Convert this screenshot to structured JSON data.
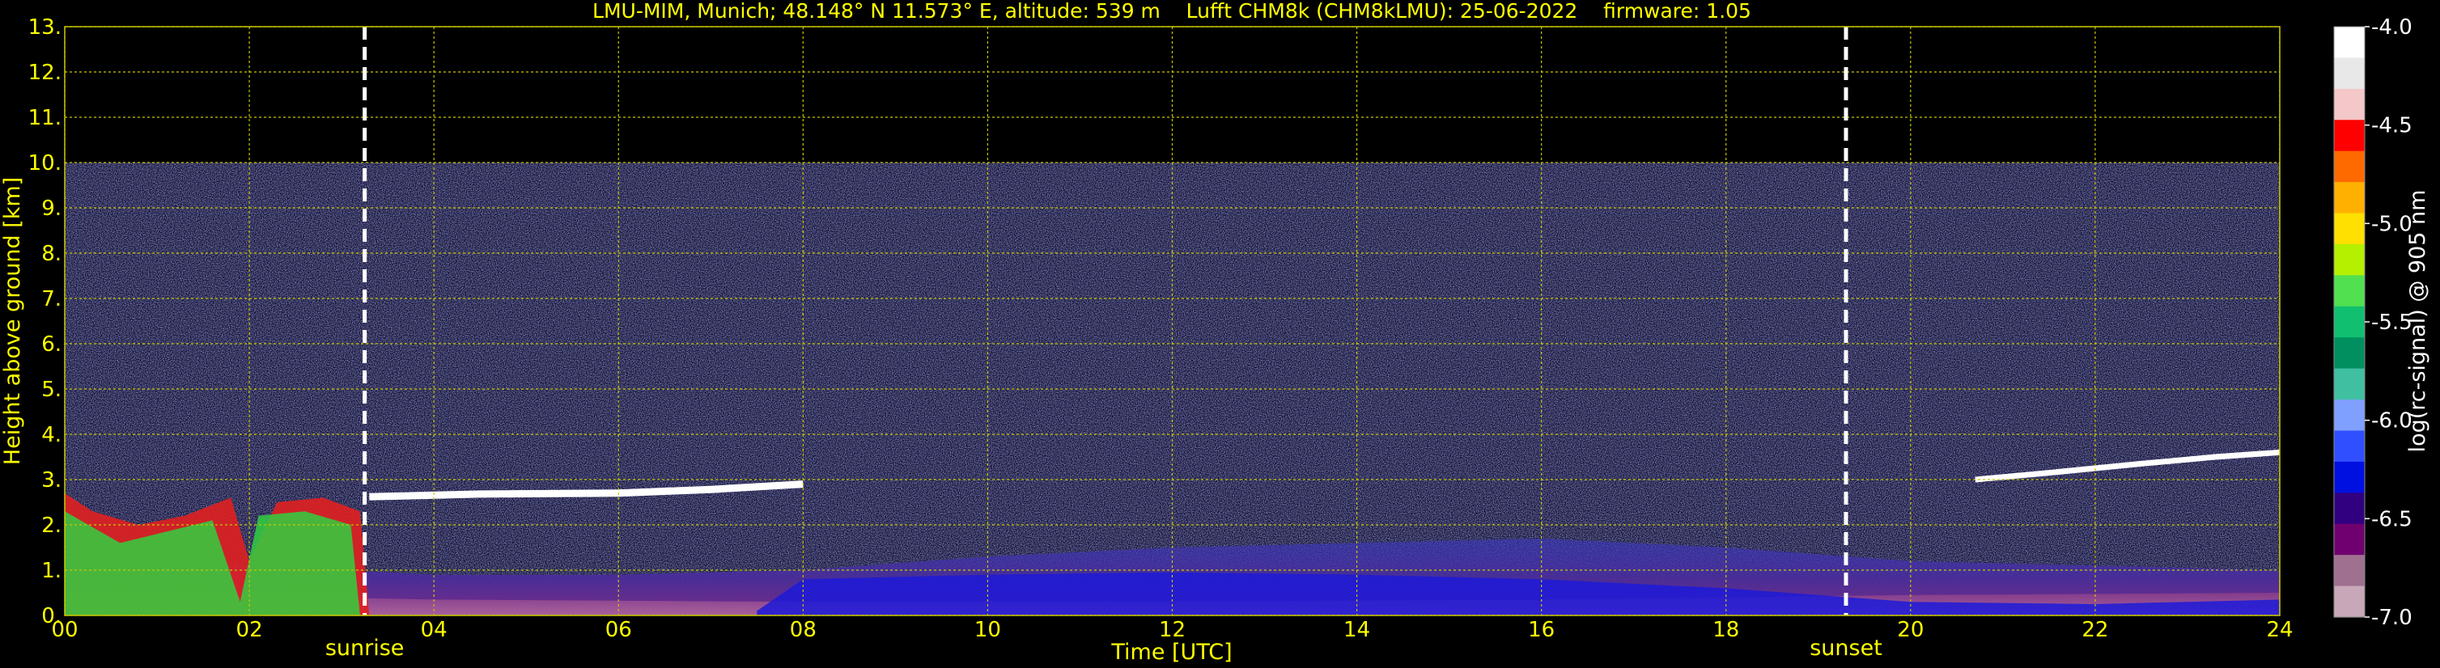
{
  "chart_data": {
    "type": "heatmap",
    "title": "LMU-MIM, Munich; 48.148° N 11.573° E, altitude: 539 m    Lufft CHM8k (CHM8kLMU): 25-06-2022    firmware: 1.05",
    "xlabel": "Time [UTC]",
    "ylabel": "Height above ground [km]",
    "xlim": [
      0,
      24
    ],
    "ylim": [
      0,
      13
    ],
    "x_ticks": [
      "00",
      "02",
      "04",
      "06",
      "08",
      "10",
      "12",
      "14",
      "16",
      "18",
      "20",
      "22",
      "24"
    ],
    "y_ticks": [
      "0.",
      "1.",
      "2.",
      "3.",
      "4.",
      "5.",
      "6.",
      "7.",
      "8.",
      "9.",
      "10.",
      "11.",
      "12.",
      "13."
    ],
    "grid": true,
    "data_ceiling_km": 10,
    "markers": [
      {
        "label": "sunrise",
        "x": 3.25
      },
      {
        "label": "sunset",
        "x": 19.3
      }
    ],
    "colorbar": {
      "label": "log(rc-signal) @ 905 nm",
      "range": [
        -7.0,
        -4.0
      ],
      "ticks": [
        "-4.0",
        "-4.5",
        "-5.0",
        "-5.5",
        "-6.0",
        "-6.5",
        "-7.0"
      ],
      "colors": [
        "#ffffff",
        "#e8e8e8",
        "#f4c8c8",
        "#ff0000",
        "#ff6a00",
        "#ffb000",
        "#ffe000",
        "#b4f000",
        "#50e050",
        "#10c070",
        "#009060",
        "#40c0a0",
        "#80a0ff",
        "#3050ff",
        "#0010e0",
        "#300080",
        "#700070",
        "#a07090",
        "#c8a8b8"
      ]
    },
    "features": [
      {
        "name": "low cloud layer early morning",
        "x": [
          0,
          3.3
        ],
        "y": [
          2.4,
          3.0
        ]
      },
      {
        "name": "aerosol layer top",
        "x": [
          3.3,
          8.0
        ],
        "y": [
          2.6,
          2.9
        ]
      },
      {
        "name": "late evening cloud layer",
        "x": [
          20.7,
          24
        ],
        "y": [
          3.0,
          3.7
        ]
      },
      {
        "name": "boundary layer",
        "x": [
          0,
          24
        ],
        "y": [
          0,
          1.7
        ]
      }
    ],
    "colors": {
      "text": "#ffff00",
      "grid": "#c8c800",
      "background": "#000000",
      "marker": "#ffffff"
    }
  }
}
